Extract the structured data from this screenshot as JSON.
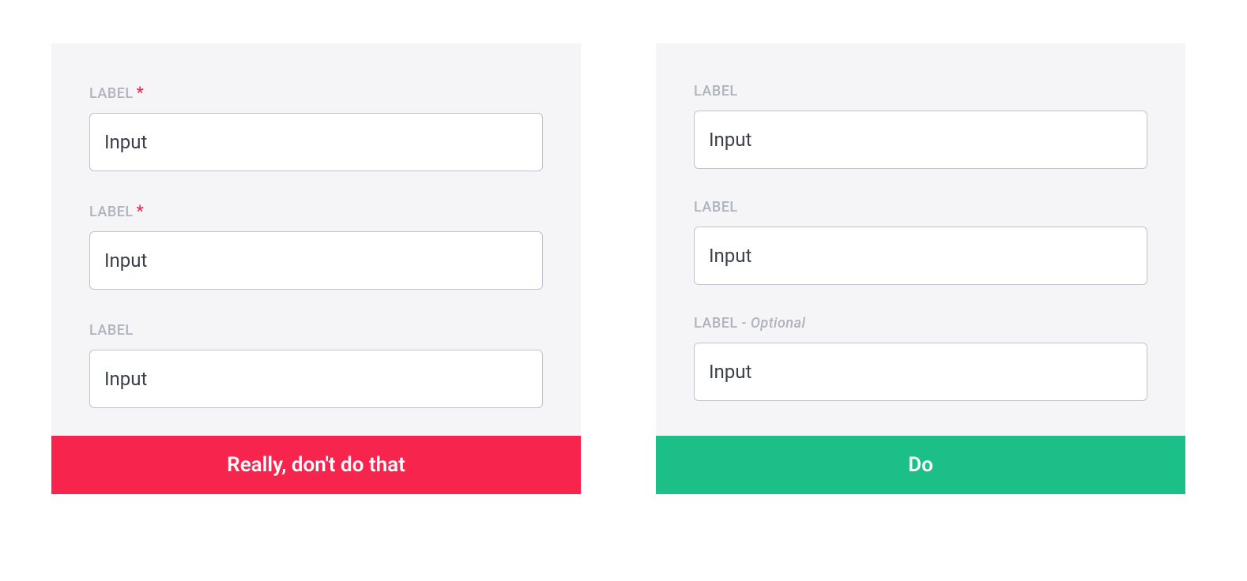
{
  "dont": {
    "fields": [
      {
        "label": "LABEL",
        "required_mark": "*",
        "value": "Input"
      },
      {
        "label": "LABEL",
        "required_mark": "*",
        "value": "Input"
      },
      {
        "label": "LABEL",
        "required_mark": "",
        "value": "Input"
      }
    ],
    "footer": "Really, don't do that"
  },
  "do": {
    "fields": [
      {
        "label": "LABEL",
        "optional_suffix": "",
        "value": "Input"
      },
      {
        "label": "LABEL",
        "optional_suffix": "",
        "value": "Input"
      },
      {
        "label": "LABEL",
        "optional_suffix": " - Optional",
        "value": "Input"
      }
    ],
    "footer": "Do"
  },
  "colors": {
    "dont_banner": "#f7244d",
    "do_banner": "#1bbf87",
    "panel_bg": "#f5f5f7",
    "label_text": "#aeb3bd",
    "input_border": "#c0c3cc"
  }
}
